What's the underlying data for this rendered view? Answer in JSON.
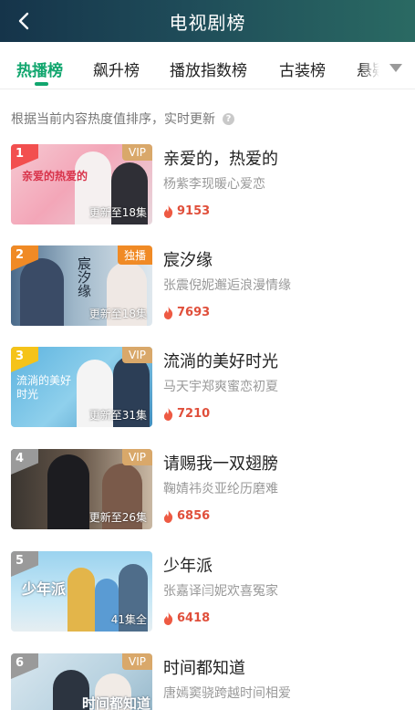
{
  "header": {
    "title": "电视剧榜",
    "back_icon": "back-icon"
  },
  "tabs": [
    {
      "label": "热播榜",
      "active": true
    },
    {
      "label": "飙升榜",
      "active": false
    },
    {
      "label": "播放指数榜",
      "active": false
    },
    {
      "label": "古装榜",
      "active": false
    },
    {
      "label": "悬疑",
      "active": false
    }
  ],
  "more_icon": "chevron-down-icon",
  "subtitle": {
    "text": "根据当前内容热度值排序，实时更新",
    "help_icon": "question-icon",
    "help_glyph": "?"
  },
  "items": [
    {
      "rank": "1",
      "badge": "VIP",
      "badge_type": "vip",
      "episodes": "更新至18集",
      "name": "亲爱的，热爱的",
      "desc": "杨紫李现暖心爱恋",
      "heat": "9153",
      "poster_text": "亲爱的热爱的",
      "rank_color": "#f24f4f"
    },
    {
      "rank": "2",
      "badge": "独播",
      "badge_type": "exclusive",
      "episodes": "更新至18集",
      "name": "宸汐缘",
      "desc": "张震倪妮邂逅浪漫情缘",
      "heat": "7693",
      "poster_text": "宸汐缘",
      "rank_color": "#f08a25"
    },
    {
      "rank": "3",
      "badge": "VIP",
      "badge_type": "vip",
      "episodes": "更新至31集",
      "name": "流淌的美好时光",
      "desc": "马天宇郑爽蜜恋初夏",
      "heat": "7210",
      "poster_text": "流淌的美好时光",
      "rank_color": "#f5c319"
    },
    {
      "rank": "4",
      "badge": "VIP",
      "badge_type": "vip",
      "episodes": "更新至26集",
      "name": "请赐我一双翅膀",
      "desc": "鞠婧祎炎亚纶历磨难",
      "heat": "6856",
      "poster_text": "",
      "rank_color": "#9a9a9a"
    },
    {
      "rank": "5",
      "badge": "",
      "badge_type": "none",
      "episodes": "41集全",
      "name": "少年派",
      "desc": "张嘉译闫妮欢喜冤家",
      "heat": "6418",
      "poster_text": "少年派",
      "rank_color": "#9a9a9a"
    },
    {
      "rank": "6",
      "badge": "VIP",
      "badge_type": "vip",
      "episodes": "",
      "name": "时间都知道",
      "desc": "唐嫣窦骁跨越时间相爱",
      "heat": "",
      "poster_text": "时间都知道",
      "rank_color": "#9a9a9a"
    }
  ]
}
